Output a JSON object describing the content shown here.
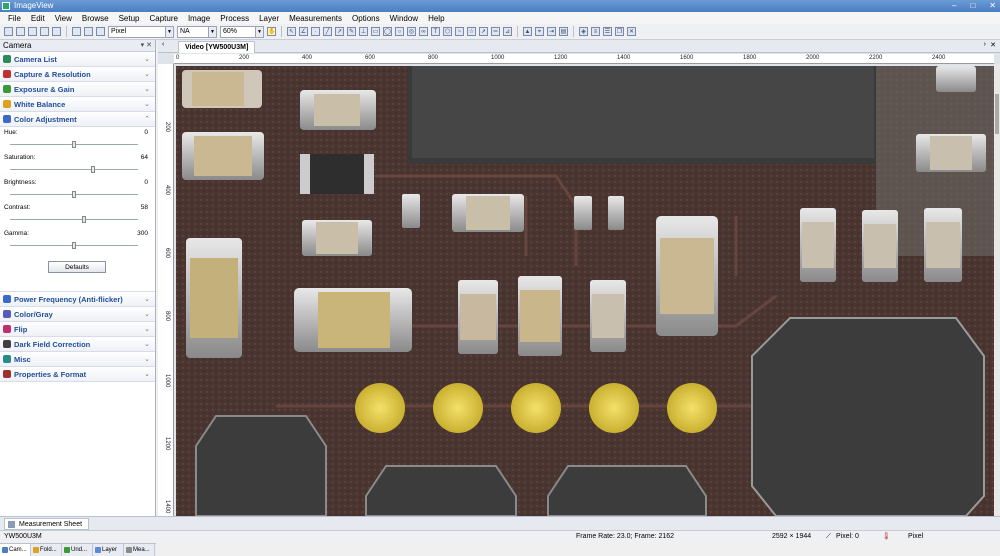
{
  "window": {
    "title": "ImageView",
    "controls": [
      "–",
      "□",
      "✕"
    ]
  },
  "menu": [
    "File",
    "Edit",
    "View",
    "Browse",
    "Setup",
    "Capture",
    "Image",
    "Process",
    "Layer",
    "Measurements",
    "Options",
    "Window",
    "Help"
  ],
  "toolbar": {
    "unit_select": "Pixel",
    "na_select": "NA",
    "zoom_select": "60%"
  },
  "left_panel": {
    "title": "Camera",
    "sections_top": [
      {
        "label": "Camera List",
        "color": "#2a8a5a"
      },
      {
        "label": "Capture & Resolution",
        "color": "#c03030"
      },
      {
        "label": "Exposure & Gain",
        "color": "#3a9a3a"
      },
      {
        "label": "White Balance",
        "color": "#e0a020"
      },
      {
        "label": "Color Adjustment",
        "color": "#3a6ac8"
      }
    ],
    "color_adjustment": {
      "hue_label": "Hue:",
      "hue_value": "0",
      "hue_fraction": 0.5,
      "saturation_label": "Saturation:",
      "saturation_value": "64",
      "saturation_fraction": 0.65,
      "brightness_label": "Brightness:",
      "brightness_value": "0",
      "brightness_fraction": 0.5,
      "contrast_label": "Contrast:",
      "contrast_value": "58",
      "contrast_fraction": 0.58,
      "gamma_label": "Gamma:",
      "gamma_value": "300",
      "gamma_fraction": 0.5,
      "defaults_button": "Defaults"
    },
    "sections_bottom": [
      {
        "label": "Power Frequency (Anti-flicker)",
        "color": "#3a6ac8"
      },
      {
        "label": "Color/Gray",
        "color": "#5a5ab8"
      },
      {
        "label": "Flip",
        "color": "#c03070"
      },
      {
        "label": "Dark Field Correction",
        "color": "#404040"
      },
      {
        "label": "Misc",
        "color": "#2a8a8a"
      },
      {
        "label": "Properties & Format",
        "color": "#a03030"
      }
    ],
    "bottom_tabs": [
      "Cam...",
      "Fold...",
      "Und...",
      "Layer",
      "Mea..."
    ]
  },
  "document": {
    "tab_label": "Video [YW500U3M]"
  },
  "ruler": {
    "h_labels": [
      "0",
      "200",
      "400",
      "600",
      "800",
      "1000",
      "1200",
      "1400",
      "1600",
      "1800",
      "2000",
      "2200",
      "2400"
    ],
    "v_labels": [
      "200",
      "400",
      "600",
      "800",
      "1000",
      "1200",
      "1400"
    ]
  },
  "sheet_tab": "Measurement Sheet",
  "status": {
    "camera": "YW500U3M",
    "frame_info": "Frame Rate: 23.0; Frame: 2162",
    "resolution": "2592 × 1944",
    "pixel_readout": "Pixel: 0",
    "unit": "Pixel"
  }
}
